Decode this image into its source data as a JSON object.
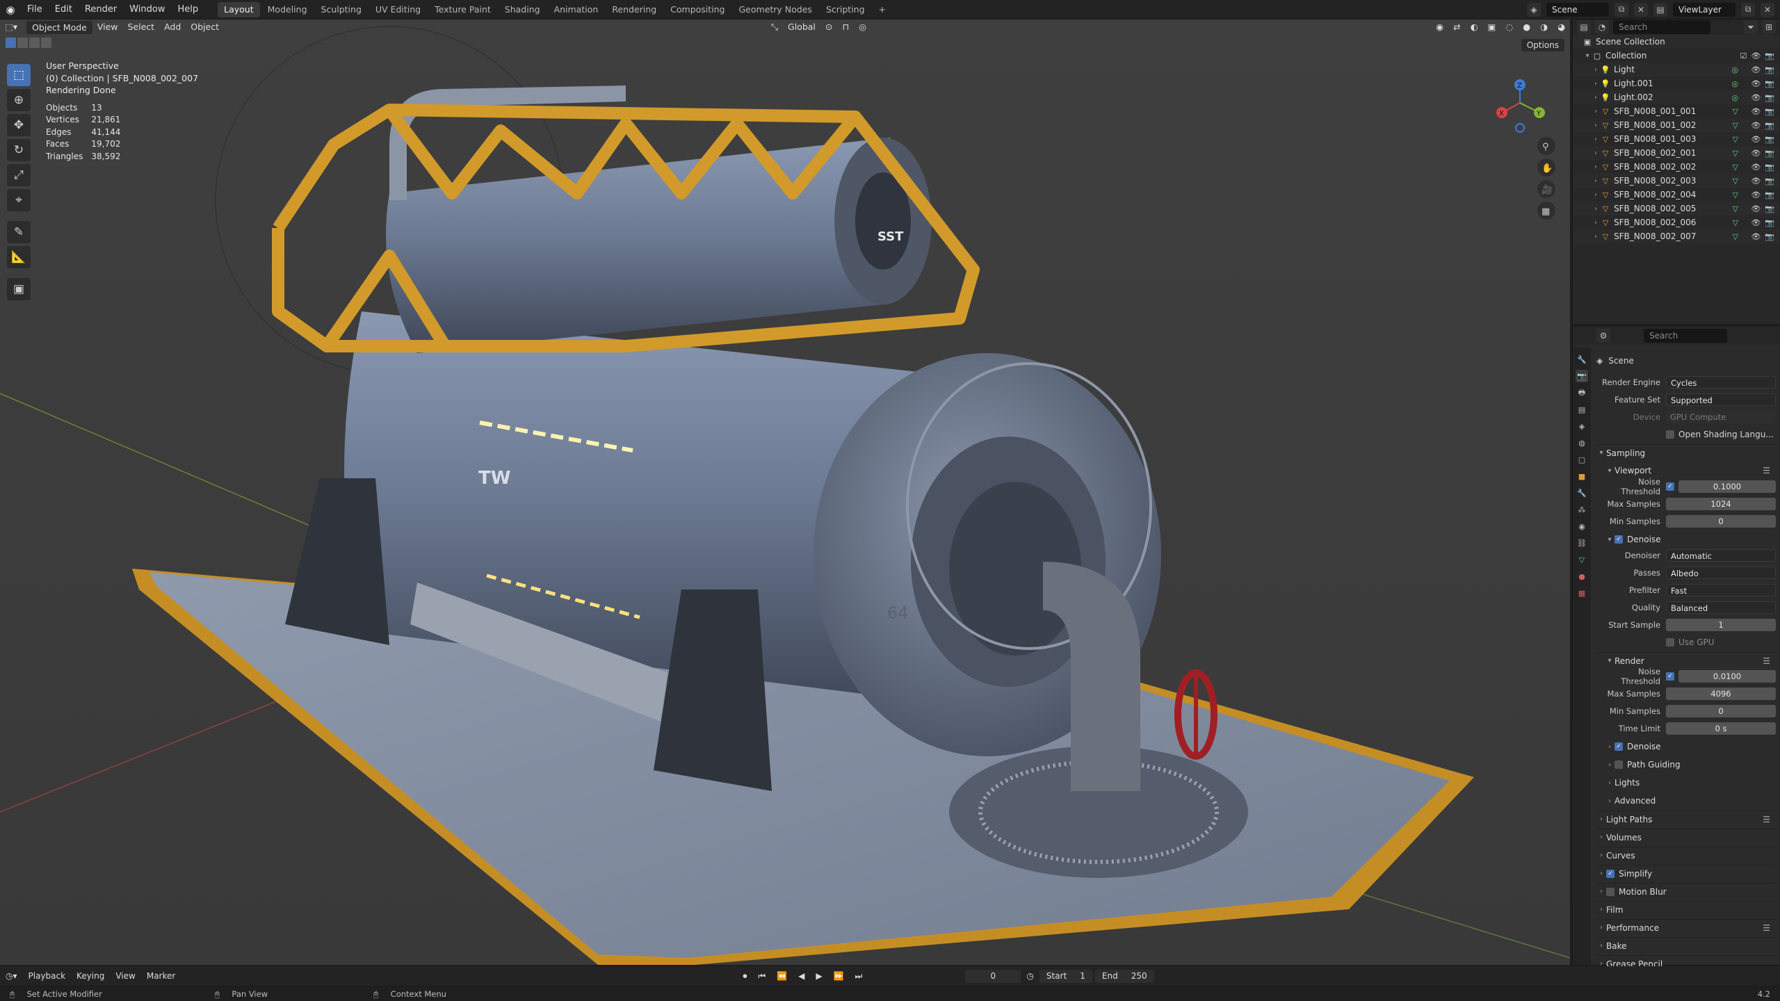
{
  "menu": {
    "items": [
      "File",
      "Edit",
      "Render",
      "Window",
      "Help"
    ]
  },
  "workspaces": [
    "Layout",
    "Modeling",
    "Sculpting",
    "UV Editing",
    "Texture Paint",
    "Shading",
    "Animation",
    "Rendering",
    "Compositing",
    "Geometry Nodes",
    "Scripting"
  ],
  "workspace_add": "+",
  "topbar": {
    "scene": "Scene",
    "view_layer": "ViewLayer"
  },
  "viewport": {
    "mode": "Object Mode",
    "menu": [
      "View",
      "Select",
      "Add",
      "Object"
    ],
    "orientation": "Global",
    "options": "Options",
    "overlay": {
      "line1": "User Perspective",
      "line2": "(0) Collection | SFB_N008_002_007",
      "line3": "Rendering Done",
      "stats": [
        {
          "label": "Objects",
          "value": "13"
        },
        {
          "label": "Vertices",
          "value": "21,861"
        },
        {
          "label": "Edges",
          "value": "41,144"
        },
        {
          "label": "Faces",
          "value": "19,702"
        },
        {
          "label": "Triangles",
          "value": "38,592"
        }
      ]
    },
    "gizmo": {
      "x": "X",
      "y": "Y",
      "z": "Z"
    },
    "model_labels": {
      "tw": "TW",
      "sst": "SST",
      "num": "64"
    }
  },
  "outliner": {
    "search_placeholder": "Search",
    "scene_collection": "Scene Collection",
    "collection": "Collection",
    "items": [
      {
        "name": "Light",
        "type": "light"
      },
      {
        "name": "Light.001",
        "type": "light"
      },
      {
        "name": "Light.002",
        "type": "light"
      },
      {
        "name": "SFB_N008_001_001",
        "type": "mesh"
      },
      {
        "name": "SFB_N008_001_002",
        "type": "mesh"
      },
      {
        "name": "SFB_N008_001_003",
        "type": "mesh"
      },
      {
        "name": "SFB_N008_002_001",
        "type": "mesh"
      },
      {
        "name": "SFB_N008_002_002",
        "type": "mesh"
      },
      {
        "name": "SFB_N008_002_003",
        "type": "mesh"
      },
      {
        "name": "SFB_N008_002_004",
        "type": "mesh"
      },
      {
        "name": "SFB_N008_002_005",
        "type": "mesh"
      },
      {
        "name": "SFB_N008_002_006",
        "type": "mesh"
      },
      {
        "name": "SFB_N008_002_007",
        "type": "mesh"
      }
    ]
  },
  "properties": {
    "search_placeholder": "Search",
    "context": "Scene",
    "render_engine": {
      "label": "Render Engine",
      "value": "Cycles"
    },
    "feature_set": {
      "label": "Feature Set",
      "value": "Supported"
    },
    "device": {
      "label": "Device",
      "value": "GPU Compute"
    },
    "osl": "Open Shading Langu...",
    "sampling": "Sampling",
    "viewport_panel": "Viewport",
    "vp_noise_threshold": {
      "label": "Noise Threshold",
      "value": "0.1000"
    },
    "vp_max_samples": {
      "label": "Max Samples",
      "value": "1024"
    },
    "vp_min_samples": {
      "label": "Min Samples",
      "value": "0"
    },
    "denoise_panel": "Denoise",
    "denoiser": {
      "label": "Denoiser",
      "value": "Automatic"
    },
    "passes": {
      "label": "Passes",
      "value": "Albedo"
    },
    "prefilter": {
      "label": "Prefilter",
      "value": "Fast"
    },
    "quality": {
      "label": "Quality",
      "value": "Balanced"
    },
    "start_sample": {
      "label": "Start Sample",
      "value": "1"
    },
    "use_gpu": "Use GPU",
    "render_panel": "Render",
    "r_noise_threshold": {
      "label": "Noise Threshold",
      "value": "0.0100"
    },
    "r_max_samples": {
      "label": "Max Samples",
      "value": "4096"
    },
    "r_min_samples": {
      "label": "Min Samples",
      "value": "0"
    },
    "r_time_limit": {
      "label": "Time Limit",
      "value": "0 s"
    },
    "sub_panels": [
      "Denoise",
      "Path Guiding",
      "Lights",
      "Advanced"
    ],
    "panels": [
      "Light Paths",
      "Volumes",
      "Curves",
      "Simplify",
      "Motion Blur",
      "Film",
      "Performance",
      "Bake",
      "Grease Pencil"
    ]
  },
  "timeline": {
    "menus": [
      "Playback",
      "Keying",
      "View",
      "Marker"
    ],
    "current_frame": "0",
    "start_label": "Start",
    "start": "1",
    "end_label": "End",
    "end": "250"
  },
  "status": {
    "left": "Set Active Modifier",
    "mid": "Pan View",
    "right": "Context Menu",
    "version": "4.2"
  },
  "colors": {
    "accent": "#4772b3",
    "frame_yellow": "#d19a2a",
    "tank": "#6b7a93"
  }
}
